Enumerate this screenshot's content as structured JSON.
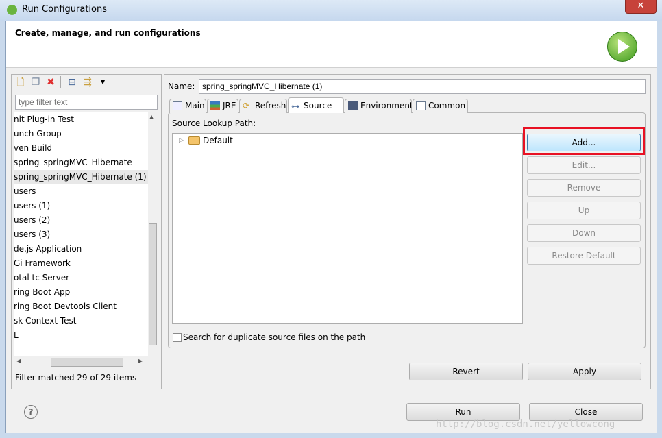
{
  "window": {
    "title": "Run Configurations",
    "close_glyph": "✕"
  },
  "header": {
    "text": "Create, manage, and run configurations"
  },
  "left": {
    "filter_placeholder": "type filter text",
    "items": [
      "nit Plug-in Test",
      "unch Group",
      "ven Build",
      "spring_springMVC_Hibernate",
      "spring_springMVC_Hibernate (1)",
      "users",
      "users (1)",
      "users (2)",
      "users (3)",
      "de.js Application",
      "Gi Framework",
      "otal tc Server",
      "ring Boot App",
      "ring Boot Devtools Client",
      "sk Context Test",
      "L"
    ],
    "selected_index": 4,
    "status": "Filter matched 29 of 29 items"
  },
  "right": {
    "name_label": "Name:",
    "name_value": "spring_springMVC_Hibernate (1)",
    "tabs": [
      "Main",
      "JRE",
      "Refresh",
      "Source",
      "Environment",
      "Common"
    ],
    "active_tab": "Source",
    "lookup_label": "Source Lookup Path:",
    "tree_item": "Default",
    "buttons": {
      "add": "Add...",
      "edit": "Edit...",
      "remove": "Remove",
      "up": "Up",
      "down": "Down",
      "restore": "Restore Default"
    },
    "checkbox_label": "Search for duplicate source files on the path",
    "revert": "Revert",
    "apply": "Apply"
  },
  "footer": {
    "run": "Run",
    "close": "Close"
  },
  "watermark": "http://blog.csdn.net/yellowcong",
  "colors": {
    "highlight": "#e81123",
    "accent": "#3d9a1c"
  }
}
